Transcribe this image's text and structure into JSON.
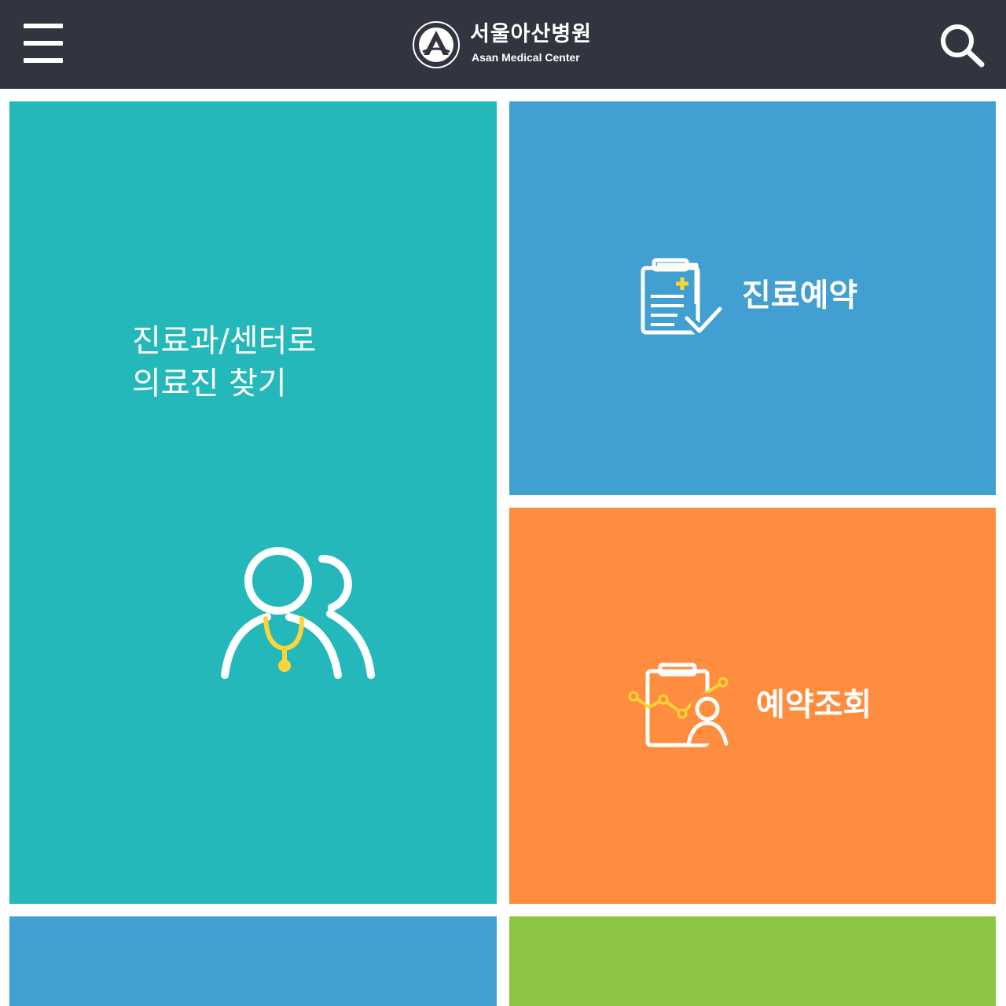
{
  "header": {
    "logo_ko": "서울아산병원",
    "logo_en": "Asan Medical Center",
    "menu_icon": "hamburger-menu-icon",
    "search_icon": "search-icon",
    "background": "#32343f"
  },
  "tiles": {
    "find": {
      "line1": "진료과/센터로",
      "line2": "의료진 찾기",
      "icon": "doctors-icon",
      "color": "#25b8ba"
    },
    "reserve": {
      "label": "진료예약",
      "icon": "clipboard-check-icon",
      "color": "#41a0d1"
    },
    "check": {
      "label": "예약조회",
      "icon": "clipboard-chart-person-icon",
      "color": "#ff8d3f"
    },
    "bottom_left": {
      "color": "#41a0d1"
    },
    "bottom_right": {
      "color": "#8cc643"
    }
  },
  "accent": "#ffd43a"
}
